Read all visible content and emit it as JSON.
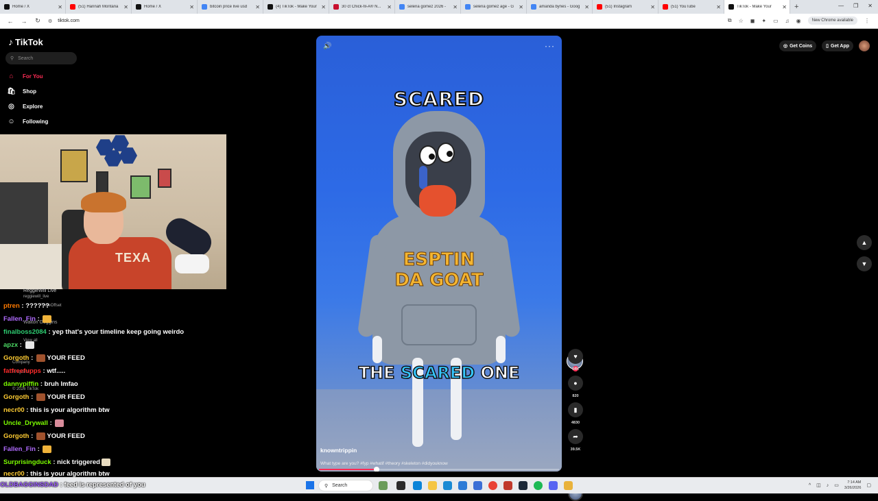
{
  "browser": {
    "tabs": [
      {
        "label": "Home / X",
        "color": "#111"
      },
      {
        "label": "(51) Hannah Montana",
        "color": "#ff0000"
      },
      {
        "label": "Home / X",
        "color": "#111"
      },
      {
        "label": "bitcoin price live usd",
        "color": "#4285f4"
      },
      {
        "label": "(4) TikTok - Make Your",
        "color": "#111"
      },
      {
        "label": "30 ct Chick-fil-A® N...",
        "color": "#c8102e"
      },
      {
        "label": "selena gomez 2026 -",
        "color": "#4285f4"
      },
      {
        "label": "selena gomez age - G",
        "color": "#4285f4"
      },
      {
        "label": "amanda bynes - Goog",
        "color": "#4285f4"
      },
      {
        "label": "(51) Instagram",
        "color": "#ff0000"
      },
      {
        "label": "(51) YouTube",
        "color": "#ff0000"
      },
      {
        "label": "TikTok - Make Your",
        "color": "#111"
      }
    ],
    "url": "tiktok.com",
    "new_chrome_label": "New Chrome available"
  },
  "sidebar": {
    "logo": "TikTok",
    "search_placeholder": "Search",
    "items": [
      {
        "label": "For You"
      },
      {
        "label": "Shop"
      },
      {
        "label": "Explore"
      },
      {
        "label": "Following"
      }
    ]
  },
  "chat": {
    "lines": [
      {
        "user": "ptren",
        "user_color": "#ff7a00",
        "msg": "??????"
      },
      {
        "user": "Fallen_Fin",
        "user_color": "#b06bff",
        "msg": ""
      },
      {
        "user": "finalboss2084",
        "user_color": "#2ecc71",
        "msg": "yep that's your timeline keep going weirdo"
      },
      {
        "user": "apzx",
        "user_color": "#4cd964",
        "msg": ""
      },
      {
        "user": "Gorgoth",
        "user_color": "#ffcc33",
        "msg": "YOUR FEED"
      },
      {
        "user": "fatfreefupps",
        "user_color": "#ff2b2b",
        "msg": "wtf....."
      },
      {
        "user": "dannypiffin",
        "user_color": "#7cfc00",
        "msg": "bruh lmfao"
      },
      {
        "user": "Gorgoth",
        "user_color": "#ffcc33",
        "msg": "YOUR FEED"
      },
      {
        "user": "necr00",
        "user_color": "#ffcc33",
        "msg": "this is your algorithm btw"
      },
      {
        "user": "Uncle_Drywall",
        "user_color": "#7cfc00",
        "msg": ""
      },
      {
        "user": "Gorgoth",
        "user_color": "#ffcc33",
        "msg": "YOUR FEED"
      },
      {
        "user": "Fallen_Fin",
        "user_color": "#b06bff",
        "msg": ""
      },
      {
        "user": "Surprisingduck",
        "user_color": "#7cfc00",
        "msg": "nick triggered"
      },
      {
        "user": "necr00",
        "user_color": "#ffcc33",
        "msg": "this is your algorithm btw"
      }
    ],
    "ghost": {
      "account1": "ReggieWill Live",
      "account1_handle": "reggiewill_live",
      "account2": "TheeOffset",
      "account3": "Walton Goggins",
      "view_all": "View all",
      "company": "Company",
      "program": "Program",
      "copyright": "© 2026 TikTok"
    },
    "ticker_user": "OLDBAGGINSDAD",
    "ticker_msg": "feed is represented of you"
  },
  "video": {
    "caption_top": "SCARED",
    "caption_bottom_a": "THE",
    "caption_bottom_b": "SCARED",
    "caption_bottom_c": "ONE",
    "hoodie_line1": "ESPTIN",
    "hoodie_line2": "DA GOAT",
    "author": "knowntrippin",
    "description": "What type are you? #fyp #whatif #theory #skeleton #didyouknow",
    "progress": 0.24
  },
  "actions": {
    "likes": "34K",
    "comments": "820",
    "saves": "4830",
    "shares": "39.5K"
  },
  "topright": {
    "coins_label": "Get Coins",
    "app_label": "Get App"
  },
  "taskbar": {
    "search_placeholder": "Search",
    "time": "7:14 AM",
    "date": "3/26/2026"
  },
  "colors": {
    "accent": "#fe2c55",
    "caption_highlight": "#35c7ff",
    "hoodie_text": "#f4b530"
  }
}
